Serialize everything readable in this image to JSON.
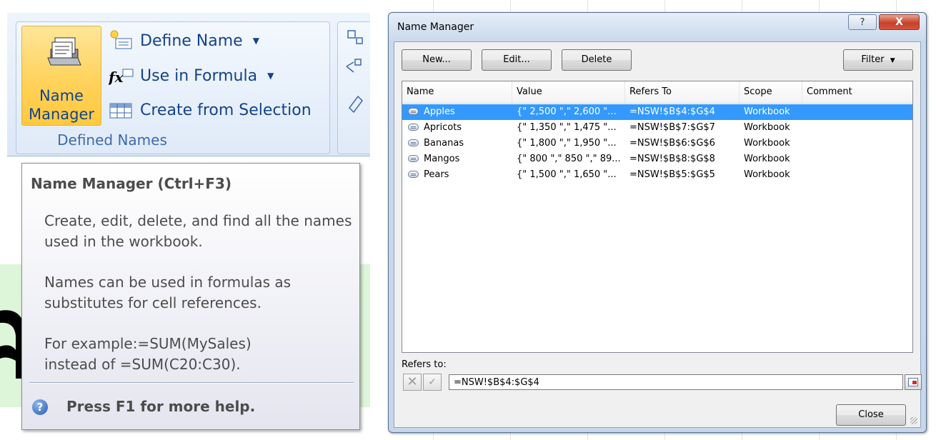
{
  "ribbon": {
    "name_manager_line1": "Name",
    "name_manager_line2": "Manager",
    "define_name": "Define Name",
    "use_in_formula": "Use in Formula",
    "create_from_selection": "Create from Selection",
    "group_label": "Defined Names"
  },
  "tooltip": {
    "title": "Name Manager (Ctrl+F3)",
    "p1": "Create, edit, delete, and find all the names used in the workbook.",
    "p2": "Names can be used in formulas as substitutes for cell references.",
    "p3_line1": "For example:=SUM(MySales)",
    "p3_line2": "instead of =SUM(C20:C30).",
    "help": "Press F1 for more help."
  },
  "dialog": {
    "title": "Name Manager",
    "help_glyph": "?",
    "close_glyph": "X",
    "buttons": {
      "new": "New...",
      "edit": "Edit...",
      "delete": "Delete",
      "filter": "Filter",
      "close": "Close"
    },
    "columns": [
      "Name",
      "Value",
      "Refers To",
      "Scope",
      "Comment"
    ],
    "rows": [
      {
        "name": "Apples",
        "value": "{\" 2,500 \",\" 2,600 \"...",
        "refers": "=NSW!$B$4:$G$4",
        "scope": "Workbook",
        "comment": "",
        "selected": true
      },
      {
        "name": "Apricots",
        "value": "{\" 1,350 \",\" 1,475 \"...",
        "refers": "=NSW!$B$7:$G$7",
        "scope": "Workbook",
        "comment": "",
        "selected": false
      },
      {
        "name": "Bananas",
        "value": "{\" 1,800 \",\" 1,950 \"...",
        "refers": "=NSW!$B$6:$G$6",
        "scope": "Workbook",
        "comment": "",
        "selected": false
      },
      {
        "name": "Mangos",
        "value": "{\" 800 \",\" 850 \",\" 89...",
        "refers": "=NSW!$B$8:$G$8",
        "scope": "Workbook",
        "comment": "",
        "selected": false
      },
      {
        "name": "Pears",
        "value": "{\" 1,500 \",\" 1,650 \"...",
        "refers": "=NSW!$B$5:$G$5",
        "scope": "Workbook",
        "comment": "",
        "selected": false
      }
    ],
    "refers_to_label": "Refers to:",
    "refers_to_value": "=NSW!$B$4:$G$4"
  },
  "colors": {
    "selection": "#3399ff",
    "ribbon_text": "#15428b",
    "highlight_button": "#ffd25c"
  }
}
